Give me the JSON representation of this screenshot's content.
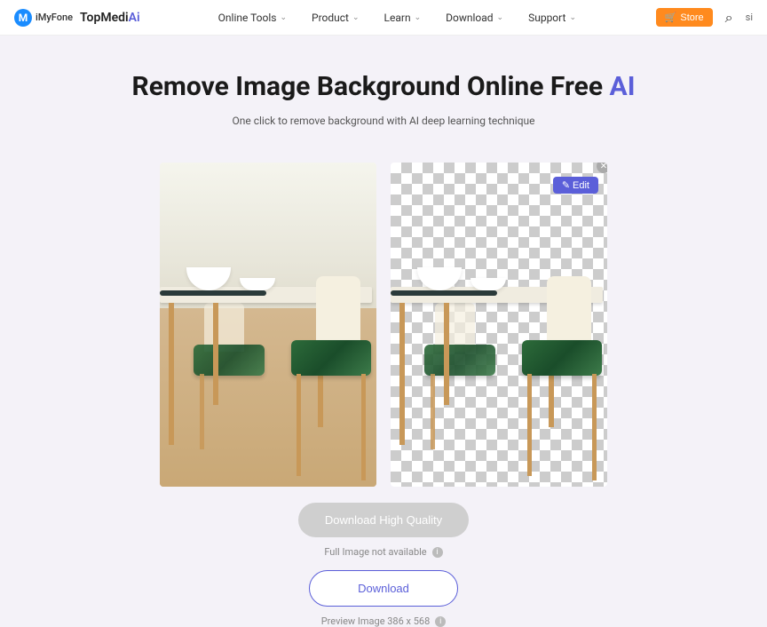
{
  "header": {
    "logo_text": "iMyFone",
    "brand": "TopMedi",
    "brand_suffix": "Ai",
    "nav": [
      {
        "label": "Online Tools"
      },
      {
        "label": "Product"
      },
      {
        "label": "Learn"
      },
      {
        "label": "Download"
      },
      {
        "label": "Support"
      }
    ],
    "store_label": "Store",
    "right_text": "si"
  },
  "hero": {
    "title": "Remove Image Background Online Free ",
    "title_ai": "AI",
    "subtitle": "One click to remove background with AI deep learning technique"
  },
  "preview": {
    "edit_label": "Edit"
  },
  "actions": {
    "hq_label": "Download High Quality",
    "not_available": "Full Image not available",
    "download_label": "Download",
    "preview_label": "Preview Image 386 x 568"
  }
}
